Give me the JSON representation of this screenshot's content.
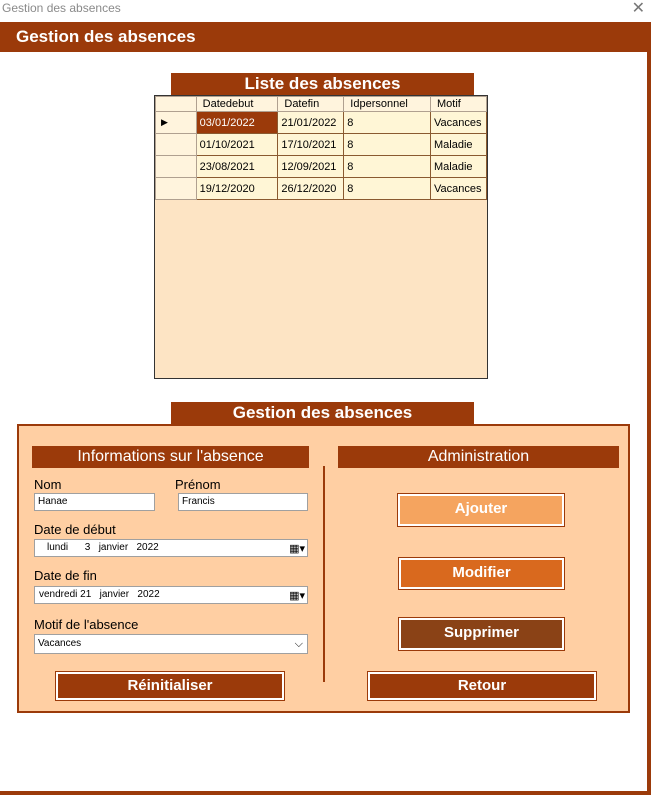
{
  "window": {
    "title": "Gestion des absences",
    "close": "✕"
  },
  "header": {
    "title": "Gestion des absences"
  },
  "list": {
    "title": "Liste des absences",
    "columns": [
      "Datedebut",
      "Datefin",
      "Idpersonnel",
      "Motif"
    ],
    "current_marker": "▶",
    "rows": [
      [
        "03/01/2022",
        "21/01/2022",
        "8",
        "Vacances"
      ],
      [
        "01/10/2021",
        "17/10/2021",
        "8",
        "Maladie"
      ],
      [
        "23/08/2021",
        "12/09/2021",
        "8",
        "Maladie"
      ],
      [
        "19/12/2020",
        "26/12/2020",
        "8",
        "Vacances"
      ]
    ]
  },
  "form": {
    "title": "Gestion des absences",
    "info_title": "Informations sur l'absence",
    "admin_title": "Administration",
    "nom_label": "Nom",
    "nom_value": "Hanae",
    "prenom_label": "Prénom",
    "prenom_value": "Francis",
    "debut_label": "Date de début",
    "debut_value": "lundi      3   janvier   2022",
    "fin_label": "Date de fin",
    "fin_value": "vendredi 21   janvier   2022",
    "motif_label": "Motif de l'absence",
    "motif_value": "Vacances",
    "reset_label": "Réinitialiser",
    "ajouter_label": "Ajouter",
    "modifier_label": "Modifier",
    "supprimer_label": "Supprimer",
    "retour_label": "Retour"
  },
  "colors": {
    "brand": "#9b3a0a",
    "ajouter": "#f5a45f",
    "modifier": "#d9691e",
    "supprimer": "#8a4216"
  }
}
